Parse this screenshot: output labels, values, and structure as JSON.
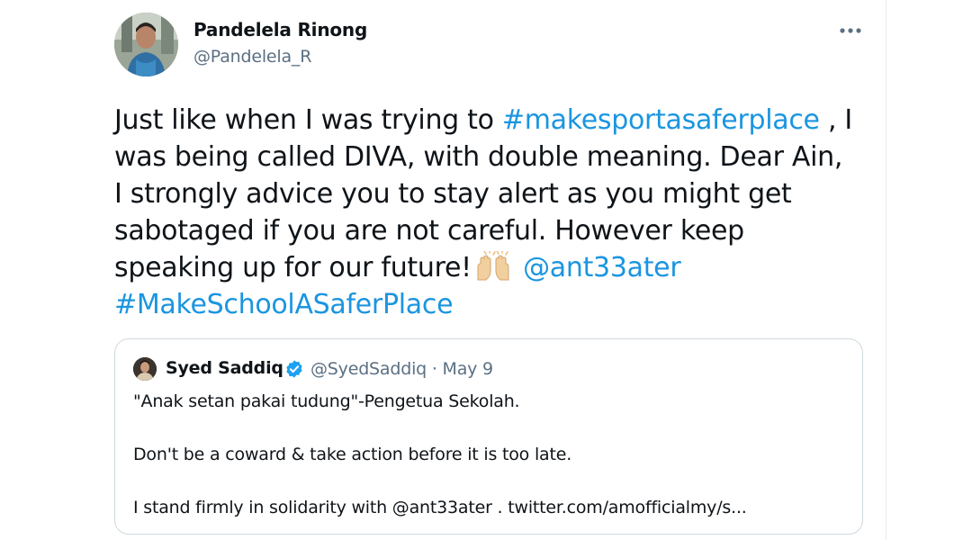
{
  "tweet": {
    "author": {
      "display_name": "Pandelela Rinong",
      "handle": "@Pandelela_R"
    },
    "more_icon": "more-horizontal-icon",
    "lines": [
      [
        {
          "t": "text",
          "v": "Just like when I was trying to "
        },
        {
          "t": "link",
          "v": "#makesportasaferplace"
        },
        {
          "t": "text",
          "v": " , I"
        }
      ],
      [
        {
          "t": "text",
          "v": "was being called DIVA, with double meaning. Dear Ain,"
        }
      ],
      [
        {
          "t": "text",
          "v": "I strongly advice you to stay alert as you might get"
        }
      ],
      [
        {
          "t": "text",
          "v": "sabotaged if you are not careful. However keep"
        }
      ],
      [
        {
          "t": "text",
          "v": "speaking up for our future!"
        },
        {
          "t": "emoji",
          "v": "raising-hands-emoji"
        },
        {
          "t": "text",
          "v": " "
        },
        {
          "t": "link",
          "v": "@ant33ater"
        }
      ],
      [
        {
          "t": "link",
          "v": "#MakeSchoolASaferPlace"
        }
      ]
    ]
  },
  "quote": {
    "author": {
      "display_name": "Syed Saddiq",
      "verified": true,
      "meta": "@SyedSaddiq · May 9"
    },
    "lines": [
      "\"Anak setan pakai tudung\"-Pengetua Sekolah.",
      "Don't be a coward & take action before it is too late.",
      "I stand firmly in solidarity with @ant33ater . twitter.com/amofficialmy/s..."
    ]
  },
  "colors": {
    "link": "#1b95e0",
    "text": "#0f1419",
    "secondary": "#5b7083",
    "border": "#cfd9de",
    "verified": "#1da1f2"
  }
}
